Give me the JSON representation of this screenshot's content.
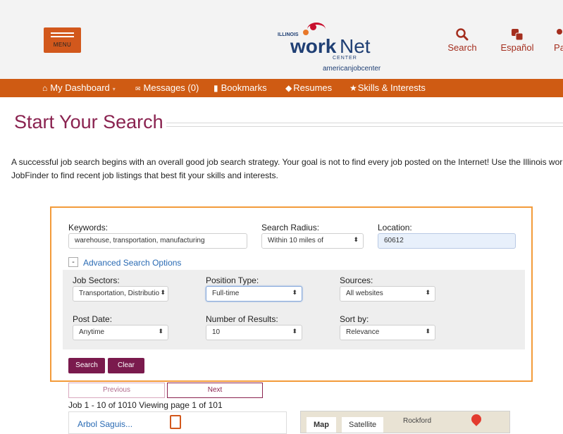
{
  "header": {
    "menu_label": "MENU",
    "logo": {
      "illinois": "ILLINOIS",
      "work": "work",
      "net": "Net",
      "center": "CENTER",
      "ajc": "americanjobcenter"
    },
    "links": [
      {
        "label": "Search",
        "icon": "search-icon"
      },
      {
        "label": "Español",
        "icon": "translate-icon"
      },
      {
        "label": "Pa",
        "icon": "profile-icon"
      }
    ]
  },
  "navbar": {
    "items": [
      {
        "label": "My Dashboard",
        "icon": "home-icon",
        "symbol": "⌂"
      },
      {
        "label": "Messages (0)",
        "icon": "mail-icon",
        "symbol": "✉"
      },
      {
        "label": "Bookmarks",
        "icon": "bookmark-icon",
        "symbol": "▮"
      },
      {
        "label": "Resumes",
        "icon": "diamond-icon",
        "symbol": "◆"
      },
      {
        "label": "Skills & Interests",
        "icon": "star-icon",
        "symbol": "★"
      }
    ]
  },
  "page": {
    "title": "Start Your Search",
    "intro_line1": "A successful job search begins with an overall good job search strategy. Your goal is not to find every job posted on the Internet! Use the Illinois workNet",
    "intro_line2": "JobFinder to find recent job listings that best fit your skills and interests."
  },
  "search": {
    "keywords_label": "Keywords:",
    "keywords_value": "warehouse, transportation, manufacturing",
    "radius_label": "Search Radius:",
    "radius_value": "Within 10 miles of",
    "location_label": "Location:",
    "location_value": "60612",
    "advanced_toggle": "-",
    "advanced_label": "Advanced Search Options",
    "job_sectors_label": "Job Sectors:",
    "job_sectors_value": "Transportation, Distributio",
    "position_type_label": "Position Type:",
    "position_type_value": "Full-time",
    "sources_label": "Sources:",
    "sources_value": "All websites",
    "post_date_label": "Post Date:",
    "post_date_value": "Anytime",
    "num_results_label": "Number of Results:",
    "num_results_value": "10",
    "sort_label": "Sort by:",
    "sort_value": "Relevance",
    "search_button": "Search",
    "clear_button": "Clear"
  },
  "pager": {
    "previous": "Previous",
    "next": "Next",
    "results_text": "Job 1 - 10 of 1010 Viewing page 1 of 101"
  },
  "results": {
    "first_title": "Arbol Saguis..."
  },
  "map": {
    "tab_map": "Map",
    "tab_satellite": "Satellite",
    "place": "Rockford"
  },
  "colors": {
    "brand_orange": "#cf5b13",
    "brand_maroon": "#7a1a4d",
    "highlight_border": "#f39b3a",
    "link_blue": "#2a6bb4"
  }
}
